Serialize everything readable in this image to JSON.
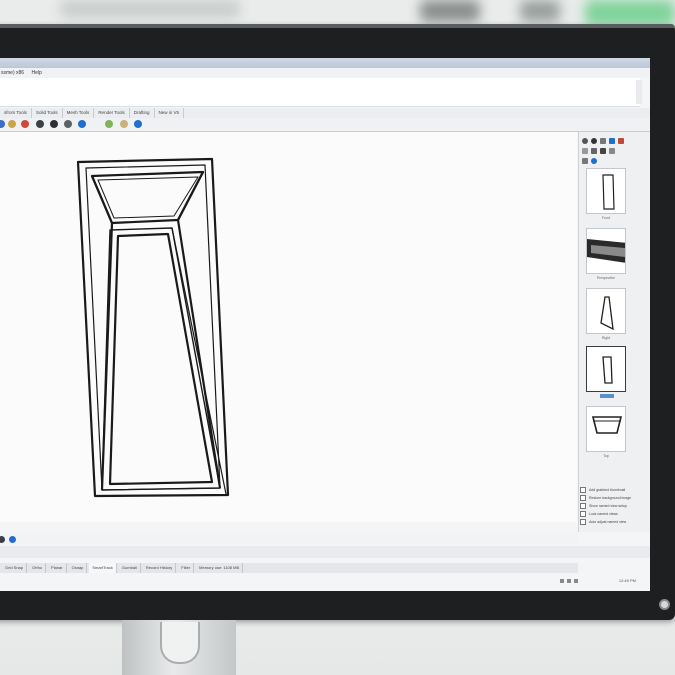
{
  "colors": {
    "bezel": "#1d1f21",
    "screen": "#f4f5f6",
    "viewport": "#fbfbfc",
    "accent_blue": "#1f6fd0",
    "model_line": "#1a1a1a"
  },
  "menubar": {
    "items": [
      "ssme) x86",
      "Help"
    ]
  },
  "tabs": [
    {
      "label": "sfrom Tools"
    },
    {
      "label": "Solid Tools"
    },
    {
      "label": "Mesh Tools"
    },
    {
      "label": "Render Tools"
    },
    {
      "label": "Drafting"
    },
    {
      "label": "New in V5"
    }
  ],
  "toolbar_icons": [
    "undo-icon",
    "lock-icon",
    "sphere-icon",
    "material-icon",
    "render-icon",
    "shade-icon",
    "ghost-icon",
    "globe-icon",
    "zoom-icon",
    "help-icon"
  ],
  "right_panel": {
    "tool_icons": [
      "cursor-icon",
      "sphere-icon",
      "cube-icon",
      "light-icon",
      "palette-icon",
      "pencil-icon",
      "link-icon",
      "close-icon",
      "settings-icon",
      "grid-icon",
      "help-icon"
    ],
    "views": [
      {
        "label": "Front"
      },
      {
        "label": "Perspective"
      },
      {
        "label": "Right"
      },
      {
        "label": ""
      },
      {
        "label": "Top"
      }
    ],
    "options": [
      {
        "label": "Add grabbed thumbnail"
      },
      {
        "label": "Restore background image"
      },
      {
        "label": "Show named view setup"
      },
      {
        "label": "Lock named views"
      },
      {
        "label": "Auto adjust named view"
      }
    ]
  },
  "statusbar": {
    "items": [
      {
        "label": "Grid Snap",
        "active": false
      },
      {
        "label": "Ortho",
        "active": false
      },
      {
        "label": "Planar",
        "active": false
      },
      {
        "label": "Osnap",
        "active": false
      },
      {
        "label": "SmartTrack",
        "active": true
      },
      {
        "label": "Gumball",
        "active": false
      },
      {
        "label": "Record History",
        "active": false
      },
      {
        "label": "Filter",
        "active": false
      },
      {
        "label": "Memory use: 1108 MB",
        "active": false
      }
    ]
  },
  "tray": {
    "clock": "12:49 PM"
  }
}
